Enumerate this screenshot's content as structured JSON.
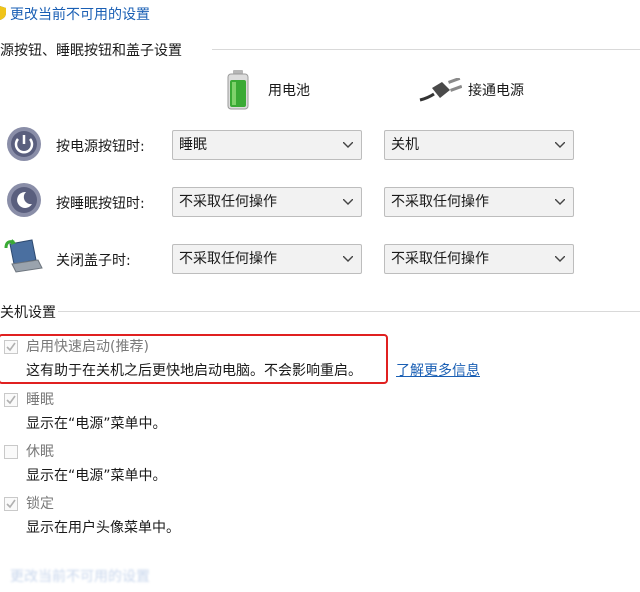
{
  "top_link": {
    "label": "更改当前不可用的设置"
  },
  "power_group": {
    "title": "源按钮、睡眠按钮和盖子设置",
    "columns": {
      "battery": "用电池",
      "plugged": "接通电源"
    },
    "rows": [
      {
        "label": "按电源按钮时:",
        "battery_value": "睡眠",
        "plugged_value": "关机"
      },
      {
        "label": "按睡眠按钮时:",
        "battery_value": "不采取任何操作",
        "plugged_value": "不采取任何操作"
      },
      {
        "label": "关闭盖子时:",
        "battery_value": "不采取任何操作",
        "plugged_value": "不采取任何操作"
      }
    ]
  },
  "shutdown_group": {
    "title": "关机设置",
    "items": [
      {
        "label": "启用快速启动(推荐)",
        "desc": "这有助于在关机之后更快地启动电脑。不会影响重启。",
        "checked": true
      },
      {
        "label": "睡眠",
        "desc": "显示在“电源”菜单中。",
        "checked": true
      },
      {
        "label": "休眠",
        "desc": "显示在“电源”菜单中。",
        "checked": false
      },
      {
        "label": "锁定",
        "desc": "显示在用户头像菜单中。",
        "checked": true
      }
    ],
    "learn_more": "了解更多信息"
  },
  "colors": {
    "link": "#1a5fb4",
    "highlight_border": "#e02020",
    "select_bg": "#f2f2f2"
  },
  "icons": [
    "shield-icon",
    "battery-icon",
    "plug-icon",
    "power-button-icon",
    "sleep-button-icon",
    "laptop-lid-icon",
    "chevron-down-icon",
    "checkmark-icon"
  ]
}
